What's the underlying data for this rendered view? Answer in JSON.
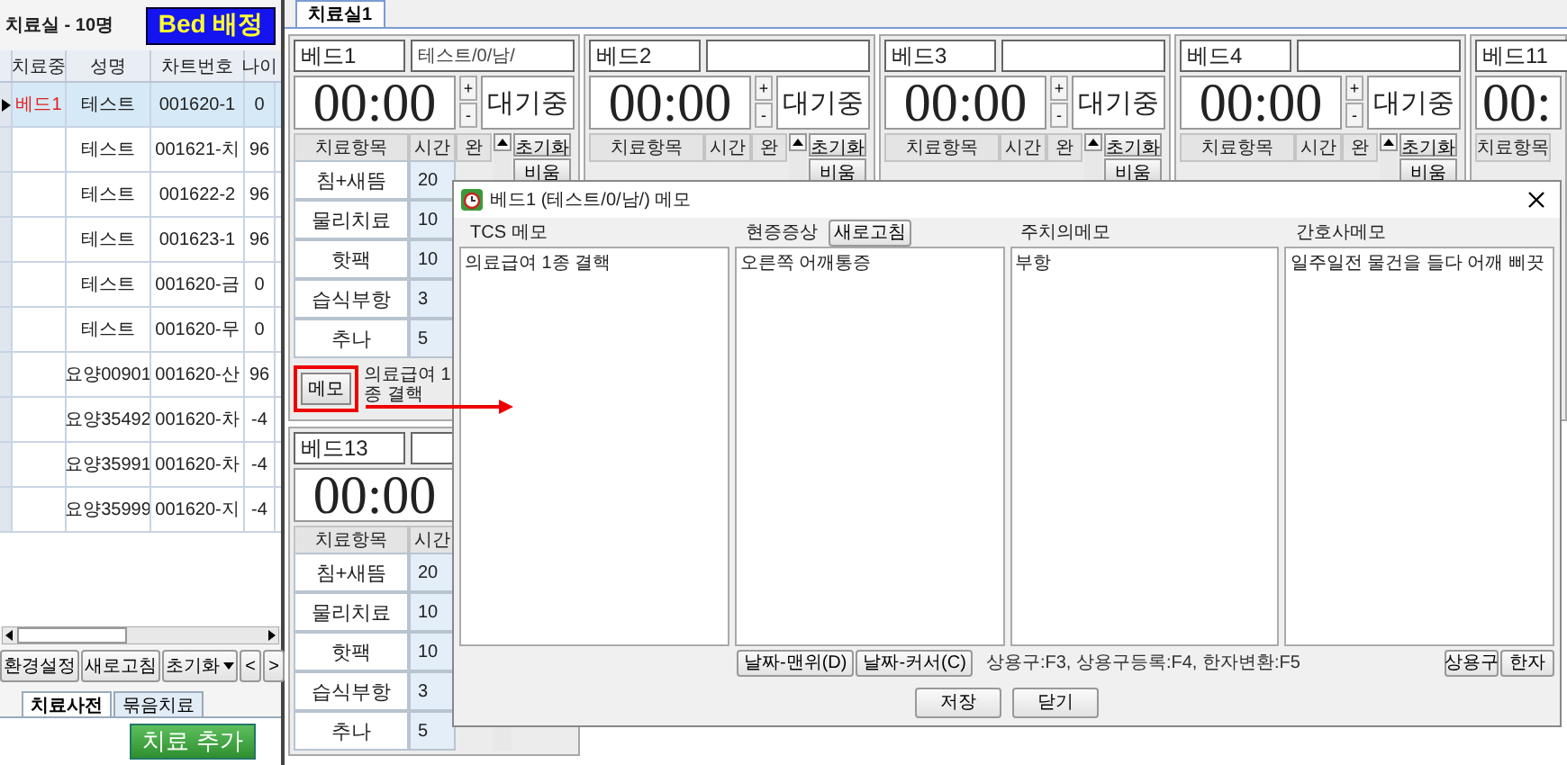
{
  "left_panel": {
    "title": "치료실 - 10명",
    "assign_button": "Bed 배정",
    "table": {
      "columns": [
        "치료중",
        "성명",
        "차트번호",
        "나이"
      ],
      "rows": [
        {
          "bed": "베드1",
          "name": "테스트",
          "chart": "001620-1",
          "age": "0",
          "selected": true
        },
        {
          "name": "테스트",
          "chart": "001621-치",
          "age": "96",
          "selected": false
        },
        {
          "name": "테스트",
          "chart": "001622-2",
          "age": "96",
          "selected": false
        },
        {
          "name": "테스트",
          "chart": "001623-1",
          "age": "96",
          "selected": false
        },
        {
          "name": "테스트",
          "chart": "001620-금",
          "age": "0",
          "selected": false
        },
        {
          "name": "테스트",
          "chart": "001620-무",
          "age": "0",
          "selected": false
        },
        {
          "name": "요양00901",
          "chart": "001620-산",
          "age": "96",
          "selected": false
        },
        {
          "name": "요양35492",
          "chart": "001620-차",
          "age": "-4",
          "selected": false
        },
        {
          "name": "요양35991",
          "chart": "001620-차",
          "age": "-4",
          "selected": false
        },
        {
          "name": "요양35999",
          "chart": "001620-지",
          "age": "-4",
          "selected": false
        }
      ]
    },
    "buttons": [
      "환경설정",
      "새로고침"
    ],
    "reset_menu": "초기화",
    "nav_buttons": [
      "<",
      ">"
    ],
    "tabs": [
      {
        "label": "치료사전",
        "selected": true
      },
      {
        "label": "묶음치료",
        "selected": false
      }
    ],
    "add_button": "치료 추가"
  },
  "room_tabs": [
    {
      "label": "치료실1",
      "selected": true
    }
  ],
  "bed_rows": [
    [
      {
        "kind": "full",
        "name": "베드1",
        "patient": "테스트/0/남/",
        "timer": "00:00",
        "spin": [
          "+",
          "-"
        ],
        "status": "대기중",
        "columns": [
          "치료항목",
          "시간",
          "완"
        ],
        "reset_button": "초기화",
        "clear_button": "비움",
        "items": [
          {
            "name": "침+새뜸",
            "minutes": "20"
          },
          {
            "name": "물리치료",
            "minutes": "10"
          },
          {
            "name": "핫팩",
            "minutes": "10"
          },
          {
            "name": "습식부항",
            "minutes": "3"
          },
          {
            "name": "추나",
            "minutes": "5"
          }
        ],
        "memo_button": "메모",
        "memo_text": "의료급여 1종 결핵"
      },
      {
        "kind": "full",
        "name": "베드2",
        "timer": "00:00",
        "spin": [
          "+",
          "-"
        ],
        "status": "대기중",
        "columns": [
          "치료항목",
          "시간",
          "완"
        ],
        "reset_button": "초기화",
        "clear_button": "비움"
      },
      {
        "kind": "full",
        "name": "베드3",
        "timer": "00:00",
        "spin": [
          "+",
          "-"
        ],
        "status": "대기중",
        "columns": [
          "치료항목",
          "시간",
          "완"
        ],
        "reset_button": "초기화",
        "clear_button": "비움"
      },
      {
        "kind": "full",
        "name": "베드4",
        "timer": "00:00",
        "spin": [
          "+",
          "-"
        ],
        "status": "대기중",
        "columns": [
          "치료항목",
          "시간",
          "완"
        ],
        "reset_button": "초기화",
        "clear_button": "비움"
      },
      {
        "kind": "cut",
        "name": "베드11",
        "timer": "00:",
        "columns": [
          "치료항목"
        ]
      }
    ],
    [
      {
        "kind": "full",
        "name": "베드13",
        "timer": "00:00",
        "columns": [
          "치료항목",
          "시간"
        ],
        "items": [
          {
            "name": "침+새뜸",
            "minutes": "20"
          },
          {
            "name": "물리치료",
            "minutes": "10"
          },
          {
            "name": "핫팩",
            "minutes": "10"
          },
          {
            "name": "습식부항",
            "minutes": "3"
          },
          {
            "name": "추나",
            "minutes": "5"
          }
        ]
      }
    ]
  ],
  "memo_dialog": {
    "title": "베드1 (테스트/0/남/) 메모",
    "sections": [
      {
        "label": "TCS 메모",
        "text": "의료급여 1종 결핵"
      },
      {
        "label": "현증증상",
        "refresh_button": "새로고침",
        "text": "오른쪽 어깨통증"
      },
      {
        "label": "주치의메모",
        "text": "부항"
      },
      {
        "label": "간호사메모",
        "text": "일주일전 물건을 들다 어깨 삐끗"
      }
    ],
    "date_buttons": [
      "날짜-맨위(D)",
      "날짜-커서(C)"
    ],
    "shortcut_hint": "상용구:F3, 상용구등록:F4, 한자변환:F5",
    "tool_buttons": [
      "상용구",
      "한자"
    ],
    "footer_buttons": [
      "저장",
      "닫기"
    ]
  }
}
